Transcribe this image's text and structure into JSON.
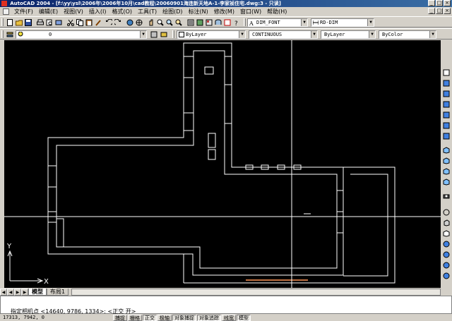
{
  "window": {
    "title": "AutoCAD 2004 - [f:\\yy\\ysl\\2006年\\2006年10月\\cad教程\\20060901海连新天地A-1-李家祯住宅.dwg:3 - 只读]",
    "minimize_symbol": "_",
    "maximize_symbol": "□",
    "close_symbol": "×"
  },
  "menu": {
    "items": [
      "文件(F)",
      "编辑(E)",
      "视图(V)",
      "插入(I)",
      "格式(O)",
      "工具(T)",
      "绘图(D)",
      "标注(N)",
      "修改(M)",
      "窗口(W)",
      "帮助(H)"
    ]
  },
  "toolbar_text": {
    "dim_style": "DIM_FONT",
    "table_style": "RD-DIM",
    "layer": "0",
    "color": "ByLayer",
    "linetype": "CONTINUOUS",
    "lineweight": "ByLayer",
    "plotstyle": "ByColor",
    "combo_arrow": "▼"
  },
  "tabs": {
    "model": "模型",
    "layout1": "布局1"
  },
  "ucs": {
    "x": "X",
    "y": "Y"
  },
  "command": {
    "line1": "",
    "line2": "指定相机点 <14640, 9786, 1334>: <正交 开>"
  },
  "status": {
    "coords": "17313, 7942, 0",
    "buttons": [
      {
        "label": "捕捉",
        "on": false
      },
      {
        "label": "栅格",
        "on": false
      },
      {
        "label": "正交",
        "on": true
      },
      {
        "label": "极轴",
        "on": false
      },
      {
        "label": "对象捕捉",
        "on": true
      },
      {
        "label": "对象追踪",
        "on": true
      },
      {
        "label": "线宽",
        "on": false
      },
      {
        "label": "模型",
        "on": true
      }
    ]
  },
  "colors": {
    "canvas_bg": "#000000",
    "drawing_lines": "#ffffff",
    "crosshair": "#ffffff",
    "highlight_line": "#c07040",
    "titlebar": "#0a246a"
  }
}
